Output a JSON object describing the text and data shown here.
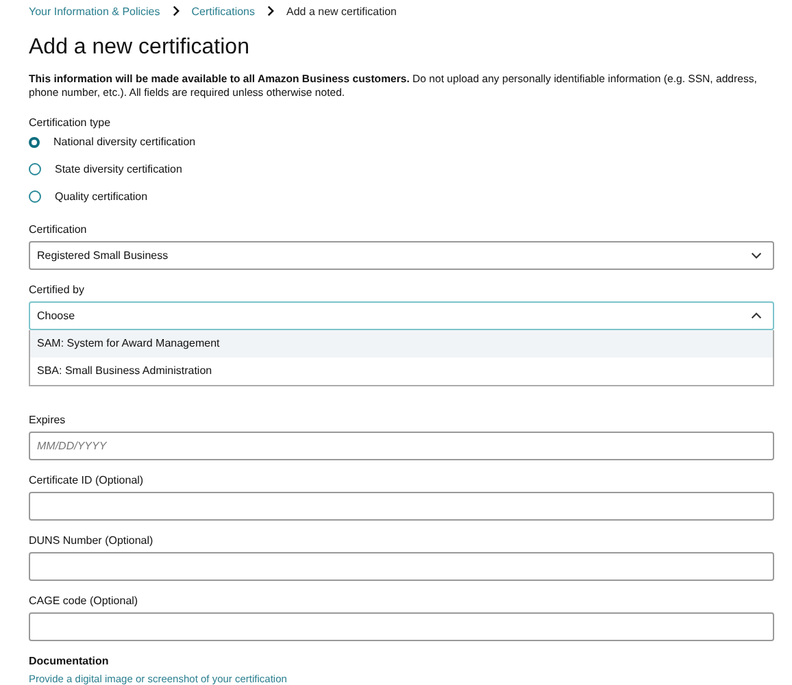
{
  "breadcrumb": [
    {
      "label": "Your Information & Policies",
      "kind": "link"
    },
    {
      "label": "Certifications",
      "kind": "link"
    },
    {
      "label": "Add a new certification",
      "kind": "current"
    }
  ],
  "title": "Add a new certification",
  "notice": "**This information will be made available to all Amazon Business customers.** Do not upload any personally identifiable information (e.g. SSN, address, phone number, etc.). All fields are required unless otherwise noted.",
  "certification_type": {
    "label": "Certification type",
    "options": [
      {
        "label": "National diversity certification",
        "selected": true
      },
      {
        "label": "State diversity certification",
        "selected": false
      },
      {
        "label": "Quality certification",
        "selected": false
      }
    ]
  },
  "fields": [
    {
      "kind": "select",
      "label": "Certification",
      "value": "Registered Small Business",
      "expanded": false
    },
    {
      "kind": "select",
      "label": "Certified by",
      "value": "Choose",
      "expanded": true,
      "options": [
        {
          "label": "SAM: System for Award Management",
          "selected": true
        },
        {
          "label": "SBA: Small Business Administration",
          "selected": false
        }
      ]
    },
    {
      "kind": "text",
      "label": "Expires",
      "placeholder": "MM/DD/YYYY"
    },
    {
      "kind": "text",
      "label": "Certificate ID (Optional)"
    },
    {
      "kind": "text",
      "label": "DUNS Number (Optional)"
    },
    {
      "kind": "text",
      "label": "CAGE code (Optional)"
    }
  ],
  "documentation": {
    "label": "Documentation",
    "hint": "Provide a digital image or screenshot of your certification"
  }
}
